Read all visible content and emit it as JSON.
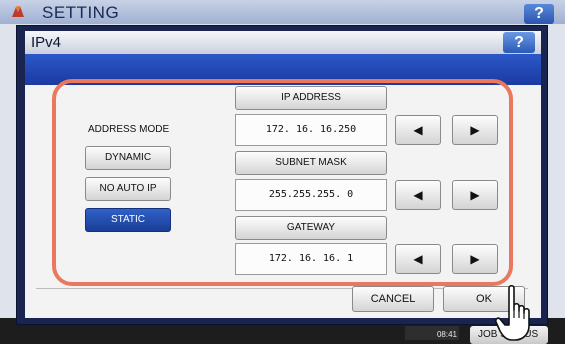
{
  "background": {
    "title": "SETTING",
    "help_label": "?",
    "clock": "08:41",
    "job_button_label": "JOB STATUS"
  },
  "dialog": {
    "title": "IPv4",
    "help_label": "?"
  },
  "address_mode": {
    "label": "ADDRESS MODE",
    "options": [
      "DYNAMIC",
      "NO AUTO IP",
      "STATIC"
    ],
    "selected": "STATIC"
  },
  "fields": [
    {
      "label": "IP ADDRESS",
      "value": "172. 16. 16.250"
    },
    {
      "label": "SUBNET MASK",
      "value": "255.255.255.  0"
    },
    {
      "label": "GATEWAY",
      "value": "172. 16. 16.  1"
    }
  ],
  "arrows": {
    "left": "◀",
    "right": "▶"
  },
  "buttons": {
    "cancel": "CANCEL",
    "ok": "OK"
  },
  "colors": {
    "highlight": "#e9785f",
    "selected_button": "#1b3d95",
    "band": "#2c58c7"
  },
  "icons": [
    "logo-icon",
    "help-icon",
    "arrow-left-icon",
    "arrow-right-icon",
    "pointing-hand-icon"
  ]
}
